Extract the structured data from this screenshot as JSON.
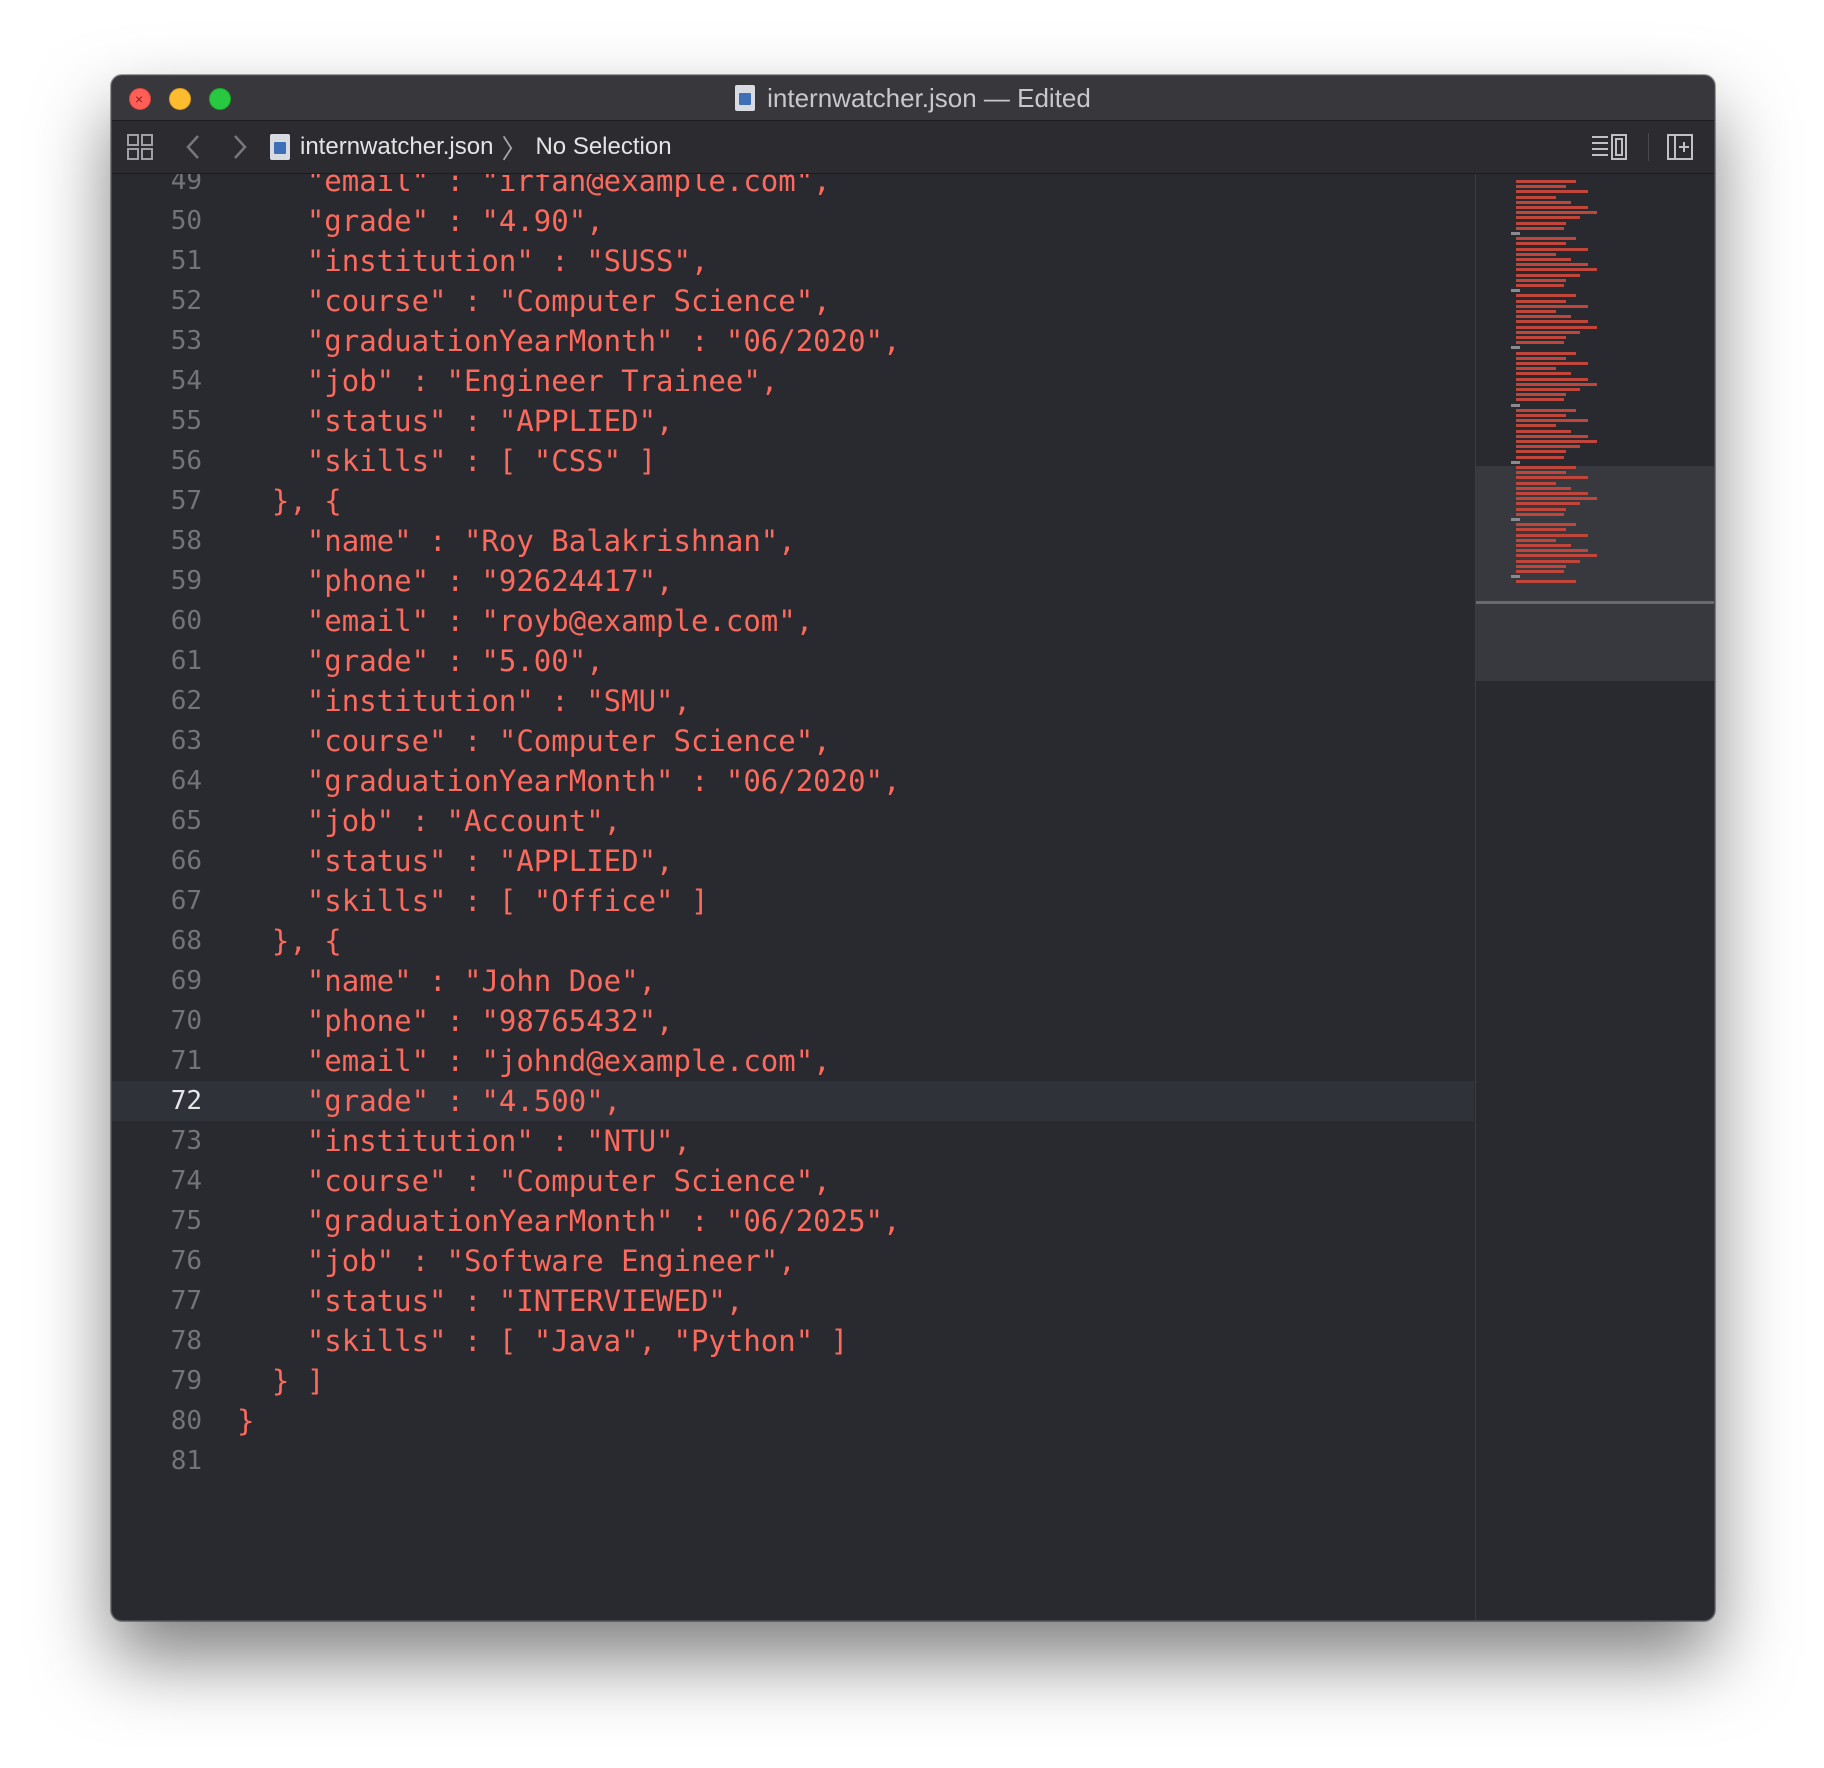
{
  "window": {
    "title": "internwatcher.json — Edited"
  },
  "jumpbar": {
    "grid_icon": "related-items-grid-icon",
    "back_icon": "back-arrow",
    "forward_icon": "forward-arrow",
    "file_name": "internwatcher.json",
    "separator": "〉",
    "selection": "No Selection",
    "adjust_editor_icon": "editor-options-icon",
    "add_editor_icon": "add-editor-icon"
  },
  "editor": {
    "current_line": 72,
    "lines": [
      {
        "num": "49",
        "text": "    \"email\" : \"irfan@example.com\","
      },
      {
        "num": "50",
        "text": "    \"grade\" : \"4.90\","
      },
      {
        "num": "51",
        "text": "    \"institution\" : \"SUSS\","
      },
      {
        "num": "52",
        "text": "    \"course\" : \"Computer Science\","
      },
      {
        "num": "53",
        "text": "    \"graduationYearMonth\" : \"06/2020\","
      },
      {
        "num": "54",
        "text": "    \"job\" : \"Engineer Trainee\","
      },
      {
        "num": "55",
        "text": "    \"status\" : \"APPLIED\","
      },
      {
        "num": "56",
        "text": "    \"skills\" : [ \"CSS\" ]"
      },
      {
        "num": "57",
        "text": "  }, {"
      },
      {
        "num": "58",
        "text": "    \"name\" : \"Roy Balakrishnan\","
      },
      {
        "num": "59",
        "text": "    \"phone\" : \"92624417\","
      },
      {
        "num": "60",
        "text": "    \"email\" : \"royb@example.com\","
      },
      {
        "num": "61",
        "text": "    \"grade\" : \"5.00\","
      },
      {
        "num": "62",
        "text": "    \"institution\" : \"SMU\","
      },
      {
        "num": "63",
        "text": "    \"course\" : \"Computer Science\","
      },
      {
        "num": "64",
        "text": "    \"graduationYearMonth\" : \"06/2020\","
      },
      {
        "num": "65",
        "text": "    \"job\" : \"Account\","
      },
      {
        "num": "66",
        "text": "    \"status\" : \"APPLIED\","
      },
      {
        "num": "67",
        "text": "    \"skills\" : [ \"Office\" ]"
      },
      {
        "num": "68",
        "text": "  }, {"
      },
      {
        "num": "69",
        "text": "    \"name\" : \"John Doe\","
      },
      {
        "num": "70",
        "text": "    \"phone\" : \"98765432\","
      },
      {
        "num": "71",
        "text": "    \"email\" : \"johnd@example.com\","
      },
      {
        "num": "72",
        "text": "    \"grade\" : \"4.500\","
      },
      {
        "num": "73",
        "text": "    \"institution\" : \"NTU\","
      },
      {
        "num": "74",
        "text": "    \"course\" : \"Computer Science\","
      },
      {
        "num": "75",
        "text": "    \"graduationYearMonth\" : \"06/2025\","
      },
      {
        "num": "76",
        "text": "    \"job\" : \"Software Engineer\","
      },
      {
        "num": "77",
        "text": "    \"status\" : \"INTERVIEWED\","
      },
      {
        "num": "78",
        "text": "    \"skills\" : [ \"Java\", \"Python\" ]"
      },
      {
        "num": "79",
        "text": "  } ]"
      },
      {
        "num": "80",
        "text": "}"
      },
      {
        "num": "81",
        "text": ""
      }
    ]
  },
  "colors": {
    "editor_background": "#292a30",
    "string_color": "#fc6a5d",
    "line_number_color": "#747478",
    "current_line_highlight": "#2f3239",
    "close_button": "#ff5f57",
    "minimize_button": "#febc2e",
    "zoom_button": "#28c840"
  }
}
